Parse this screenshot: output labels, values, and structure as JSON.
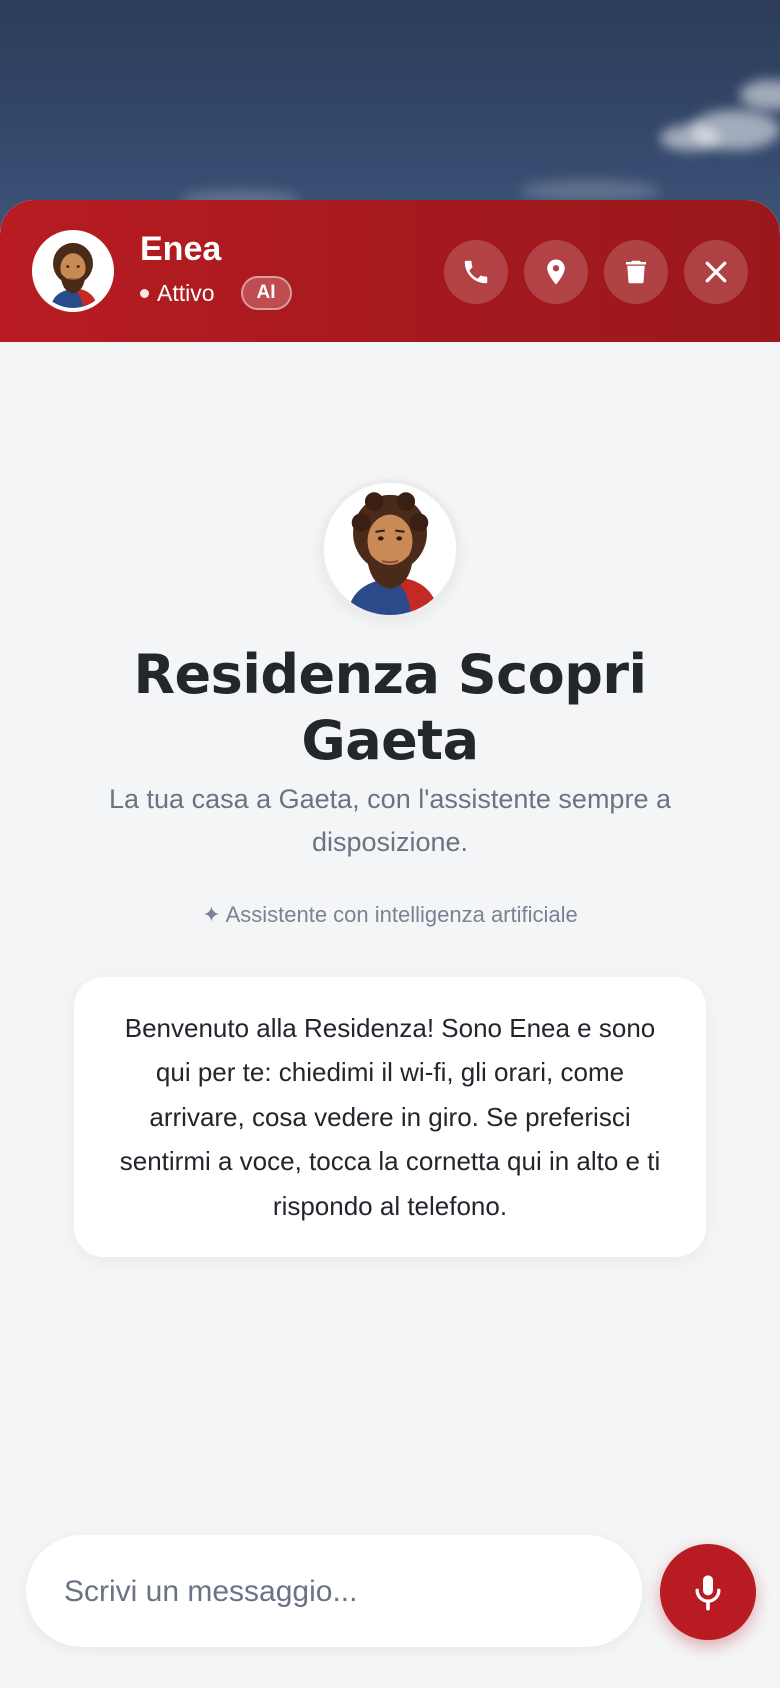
{
  "header": {
    "bot_name": "Enea",
    "status": "Attivo",
    "badge": "AI",
    "actions": [
      {
        "name": "call",
        "icon": "phone-icon"
      },
      {
        "name": "location",
        "icon": "map-pin-icon"
      },
      {
        "name": "clear",
        "icon": "trash-icon"
      },
      {
        "name": "close",
        "icon": "close-icon"
      }
    ]
  },
  "hero": {
    "title": "Residenza Scopri Gaeta",
    "subtitle": "La tua casa a Gaeta, con l'assistente sempre a disposizione.",
    "ai_note": "✦ Assistente con intelligenza artificiale"
  },
  "welcome": {
    "message": "Benvenuto alla Residenza! Sono Enea e sono qui per te: chiedimi il wi-fi, gli orari, come arrivare, cosa vedere in giro. Se preferisci sentirmi a voce, tocca la cornetta qui in alto e ti rispondo al telefono."
  },
  "composer": {
    "placeholder": "Scrivi un messaggio..."
  },
  "colors": {
    "brand_red": "#b81c22",
    "background": "#f4f5f7",
    "sky": "#2d3d5a"
  }
}
